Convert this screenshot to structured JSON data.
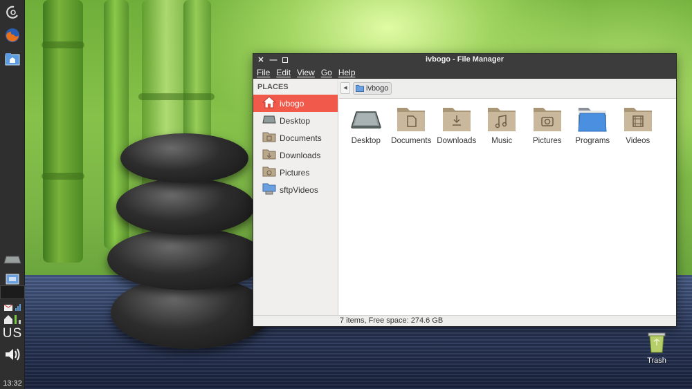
{
  "window": {
    "title": "ivbogo - File Manager",
    "menus": [
      "File",
      "Edit",
      "View",
      "Go",
      "Help"
    ]
  },
  "sidebar": {
    "heading": "PLACES",
    "items": [
      {
        "label": "ivbogo",
        "icon": "home-icon",
        "selected": true
      },
      {
        "label": "Desktop",
        "icon": "desktop-icon"
      },
      {
        "label": "Documents",
        "icon": "folder-documents-icon"
      },
      {
        "label": "Downloads",
        "icon": "folder-downloads-icon"
      },
      {
        "label": "Pictures",
        "icon": "folder-pictures-icon"
      },
      {
        "label": "sftpVideos",
        "icon": "network-folder-icon"
      }
    ]
  },
  "pathbar": {
    "crumb": "ivbogo",
    "back_glyph": "◀"
  },
  "files": [
    {
      "label": "Desktop",
      "icon": "desktop-icon"
    },
    {
      "label": "Documents",
      "icon": "folder-documents-icon"
    },
    {
      "label": "Downloads",
      "icon": "folder-downloads-icon"
    },
    {
      "label": "Music",
      "icon": "folder-music-icon"
    },
    {
      "label": "Pictures",
      "icon": "folder-pictures-icon"
    },
    {
      "label": "Programs",
      "icon": "folder-blue-icon"
    },
    {
      "label": "Videos",
      "icon": "folder-videos-icon"
    }
  ],
  "status": "7 items, Free space: 274.6 GB",
  "panel": {
    "keyboard_layout": "US",
    "clock": "13:32"
  },
  "desktop": {
    "trash_label": "Trash"
  },
  "colors": {
    "selection": "#f1594b",
    "titlebar": "#3c3c3c",
    "folder": "#c9b89b",
    "folder_blue": "#4a8fe0"
  }
}
